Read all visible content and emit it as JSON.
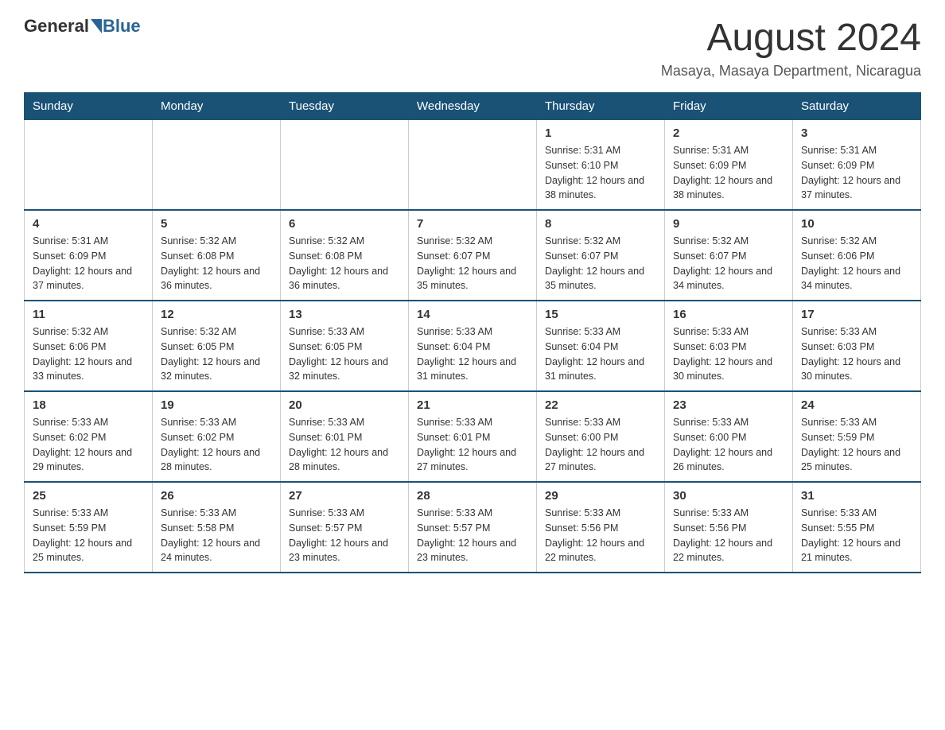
{
  "logo": {
    "general": "General",
    "blue": "Blue"
  },
  "title": "August 2024",
  "location": "Masaya, Masaya Department, Nicaragua",
  "headers": [
    "Sunday",
    "Monday",
    "Tuesday",
    "Wednesday",
    "Thursday",
    "Friday",
    "Saturday"
  ],
  "weeks": [
    [
      {
        "day": "",
        "info": ""
      },
      {
        "day": "",
        "info": ""
      },
      {
        "day": "",
        "info": ""
      },
      {
        "day": "",
        "info": ""
      },
      {
        "day": "1",
        "info": "Sunrise: 5:31 AM\nSunset: 6:10 PM\nDaylight: 12 hours and 38 minutes."
      },
      {
        "day": "2",
        "info": "Sunrise: 5:31 AM\nSunset: 6:09 PM\nDaylight: 12 hours and 38 minutes."
      },
      {
        "day": "3",
        "info": "Sunrise: 5:31 AM\nSunset: 6:09 PM\nDaylight: 12 hours and 37 minutes."
      }
    ],
    [
      {
        "day": "4",
        "info": "Sunrise: 5:31 AM\nSunset: 6:09 PM\nDaylight: 12 hours and 37 minutes."
      },
      {
        "day": "5",
        "info": "Sunrise: 5:32 AM\nSunset: 6:08 PM\nDaylight: 12 hours and 36 minutes."
      },
      {
        "day": "6",
        "info": "Sunrise: 5:32 AM\nSunset: 6:08 PM\nDaylight: 12 hours and 36 minutes."
      },
      {
        "day": "7",
        "info": "Sunrise: 5:32 AM\nSunset: 6:07 PM\nDaylight: 12 hours and 35 minutes."
      },
      {
        "day": "8",
        "info": "Sunrise: 5:32 AM\nSunset: 6:07 PM\nDaylight: 12 hours and 35 minutes."
      },
      {
        "day": "9",
        "info": "Sunrise: 5:32 AM\nSunset: 6:07 PM\nDaylight: 12 hours and 34 minutes."
      },
      {
        "day": "10",
        "info": "Sunrise: 5:32 AM\nSunset: 6:06 PM\nDaylight: 12 hours and 34 minutes."
      }
    ],
    [
      {
        "day": "11",
        "info": "Sunrise: 5:32 AM\nSunset: 6:06 PM\nDaylight: 12 hours and 33 minutes."
      },
      {
        "day": "12",
        "info": "Sunrise: 5:32 AM\nSunset: 6:05 PM\nDaylight: 12 hours and 32 minutes."
      },
      {
        "day": "13",
        "info": "Sunrise: 5:33 AM\nSunset: 6:05 PM\nDaylight: 12 hours and 32 minutes."
      },
      {
        "day": "14",
        "info": "Sunrise: 5:33 AM\nSunset: 6:04 PM\nDaylight: 12 hours and 31 minutes."
      },
      {
        "day": "15",
        "info": "Sunrise: 5:33 AM\nSunset: 6:04 PM\nDaylight: 12 hours and 31 minutes."
      },
      {
        "day": "16",
        "info": "Sunrise: 5:33 AM\nSunset: 6:03 PM\nDaylight: 12 hours and 30 minutes."
      },
      {
        "day": "17",
        "info": "Sunrise: 5:33 AM\nSunset: 6:03 PM\nDaylight: 12 hours and 30 minutes."
      }
    ],
    [
      {
        "day": "18",
        "info": "Sunrise: 5:33 AM\nSunset: 6:02 PM\nDaylight: 12 hours and 29 minutes."
      },
      {
        "day": "19",
        "info": "Sunrise: 5:33 AM\nSunset: 6:02 PM\nDaylight: 12 hours and 28 minutes."
      },
      {
        "day": "20",
        "info": "Sunrise: 5:33 AM\nSunset: 6:01 PM\nDaylight: 12 hours and 28 minutes."
      },
      {
        "day": "21",
        "info": "Sunrise: 5:33 AM\nSunset: 6:01 PM\nDaylight: 12 hours and 27 minutes."
      },
      {
        "day": "22",
        "info": "Sunrise: 5:33 AM\nSunset: 6:00 PM\nDaylight: 12 hours and 27 minutes."
      },
      {
        "day": "23",
        "info": "Sunrise: 5:33 AM\nSunset: 6:00 PM\nDaylight: 12 hours and 26 minutes."
      },
      {
        "day": "24",
        "info": "Sunrise: 5:33 AM\nSunset: 5:59 PM\nDaylight: 12 hours and 25 minutes."
      }
    ],
    [
      {
        "day": "25",
        "info": "Sunrise: 5:33 AM\nSunset: 5:59 PM\nDaylight: 12 hours and 25 minutes."
      },
      {
        "day": "26",
        "info": "Sunrise: 5:33 AM\nSunset: 5:58 PM\nDaylight: 12 hours and 24 minutes."
      },
      {
        "day": "27",
        "info": "Sunrise: 5:33 AM\nSunset: 5:57 PM\nDaylight: 12 hours and 23 minutes."
      },
      {
        "day": "28",
        "info": "Sunrise: 5:33 AM\nSunset: 5:57 PM\nDaylight: 12 hours and 23 minutes."
      },
      {
        "day": "29",
        "info": "Sunrise: 5:33 AM\nSunset: 5:56 PM\nDaylight: 12 hours and 22 minutes."
      },
      {
        "day": "30",
        "info": "Sunrise: 5:33 AM\nSunset: 5:56 PM\nDaylight: 12 hours and 22 minutes."
      },
      {
        "day": "31",
        "info": "Sunrise: 5:33 AM\nSunset: 5:55 PM\nDaylight: 12 hours and 21 minutes."
      }
    ]
  ]
}
